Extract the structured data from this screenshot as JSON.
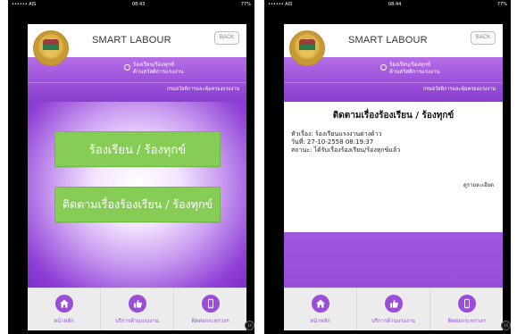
{
  "left_phone": {
    "status": {
      "carrier": "•••••• AIS",
      "time": "08:43",
      "battery": "77%"
    },
    "header": {
      "title": "SMART LABOUR",
      "back_label": "BACK"
    },
    "band": {
      "service_line1": "ร้องเรียน/ร้องทุกข์",
      "service_line2": "ด้านสวัสดิการแรงงาน",
      "department": "กรมสวัสดิการและคุ้มครองแรงงาน"
    },
    "buttons": {
      "complain": "ร้องเรียน / ร้องทุกข์",
      "track": "ติดตามเรื่องร้องเรียน / ร้องทุกข์"
    },
    "tabs": [
      {
        "label": "หน้าหลัก",
        "icon": "home-icon"
      },
      {
        "label": "บริการด้านแรงงาน",
        "icon": "thumbs-up-icon"
      },
      {
        "label": "ติดต่อกระทรวงฯ",
        "icon": "phone-icon"
      }
    ],
    "assistive_label": "1X"
  },
  "right_phone": {
    "status": {
      "carrier": "•••••• AIS",
      "time": "08:44",
      "battery": "77%"
    },
    "header": {
      "title": "SMART LABOUR",
      "back_label": "BACK"
    },
    "band": {
      "service_line1": "ร้องเรียน/ร้องทุกข์",
      "service_line2": "ด้านสวัสดิการแรงงาน",
      "department": "กรมสวัสดิการและคุ้มครองแรงงาน"
    },
    "card": {
      "title": "ติดตามเรื่องร้องเรียน / ร้องทุกข์",
      "subject": "หัวเรื่อง: ร้องเรียนแรงงานต่างด้าว",
      "date": "วันที่: 27-10-2558 08:19:37",
      "status": "สถานะ: ได้รับเรื่องร้องเรียน/ร้องทุกข์แล้ว",
      "detail_link": "ดูรายละเอียด"
    },
    "tabs": [
      {
        "label": "หน้าหลัก",
        "icon": "home-icon"
      },
      {
        "label": "บริการด้านแรงงาน",
        "icon": "thumbs-up-icon"
      },
      {
        "label": "ติดต่อกระทรวงฯ",
        "icon": "phone-icon"
      }
    ],
    "assistive_label": "1X"
  },
  "colors": {
    "accent_purple": "#9a4ed8",
    "button_green": "#86cc55"
  }
}
